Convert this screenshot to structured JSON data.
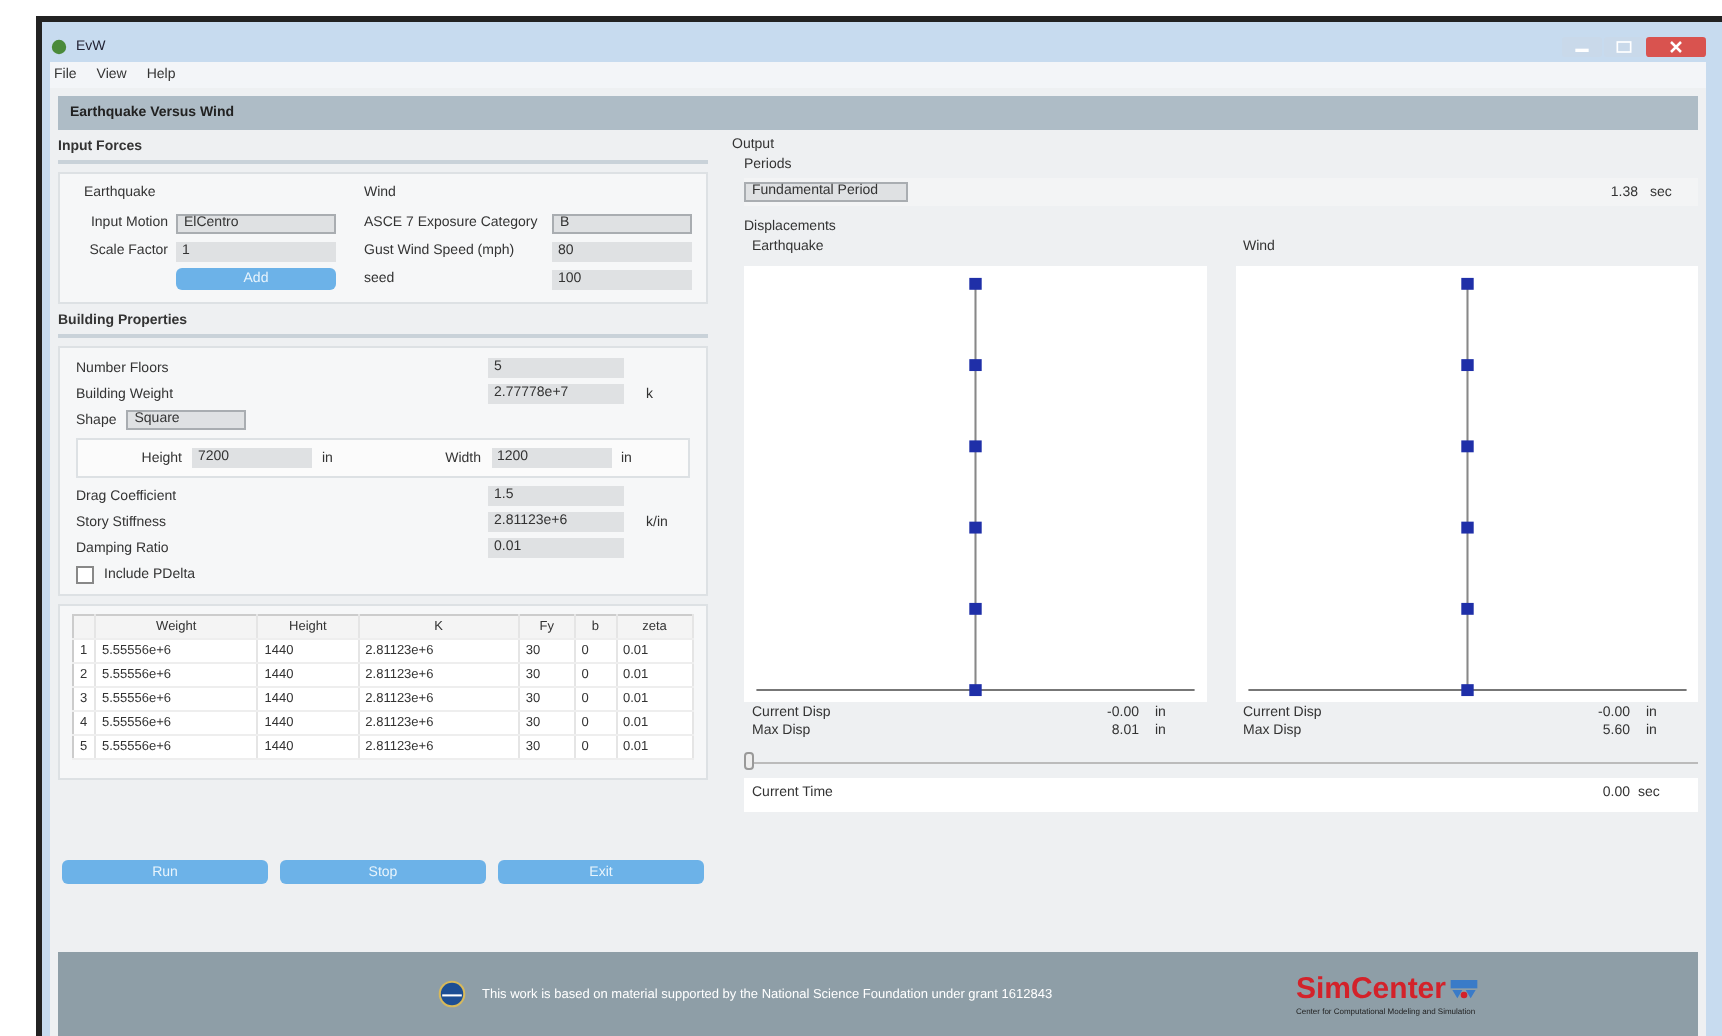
{
  "window": {
    "title": "EvW"
  },
  "menu": [
    "File",
    "View",
    "Help"
  ],
  "header": "Earthquake Versus Wind",
  "input_forces": {
    "title": "Input Forces",
    "earthquake": {
      "title": "Earthquake",
      "fields": [
        {
          "label": "Input Motion",
          "value": "ElCentro",
          "kind": "dropdown"
        },
        {
          "label": "Scale Factor",
          "value": "1",
          "kind": "text"
        }
      ],
      "button": "Add"
    },
    "wind": {
      "title": "Wind",
      "fields": [
        {
          "label": "ASCE 7 Exposure Category",
          "value": "B",
          "kind": "dropdown"
        },
        {
          "label": "Gust Wind Speed (mph)",
          "value": "80",
          "kind": "text"
        },
        {
          "label": "seed",
          "value": "100",
          "kind": "text"
        }
      ]
    }
  },
  "building": {
    "title": "Building Properties",
    "fields": [
      {
        "label": "Number Floors",
        "value": "5"
      },
      {
        "label": "Building Weight",
        "value": "2.77778e+7",
        "unit": "k"
      }
    ],
    "shape": {
      "label": "Shape",
      "value": "Square"
    },
    "dims": [
      {
        "label": "Height",
        "value": "7200",
        "unit": "in"
      },
      {
        "label": "Width",
        "value": "1200",
        "unit": "in"
      }
    ],
    "fields2": [
      {
        "label": "Drag Coefficient",
        "value": "1.5"
      },
      {
        "label": "Story Stiffness",
        "value": "2.81123e+6",
        "unit": "k/in"
      },
      {
        "label": "Damping Ratio",
        "value": "0.01"
      }
    ],
    "pdelta": {
      "label": "Include PDelta",
      "checked": false
    }
  },
  "table": {
    "columns": [
      "Weight",
      "Height",
      "K",
      "Fy",
      "b",
      "zeta"
    ],
    "rows": [
      {
        "index": "1",
        "cells": [
          "5.55556e+6",
          "1440",
          "2.81123e+6",
          "30",
          "0",
          "0.01"
        ]
      },
      {
        "index": "2",
        "cells": [
          "5.55556e+6",
          "1440",
          "2.81123e+6",
          "30",
          "0",
          "0.01"
        ]
      },
      {
        "index": "3",
        "cells": [
          "5.55556e+6",
          "1440",
          "2.81123e+6",
          "30",
          "0",
          "0.01"
        ]
      },
      {
        "index": "4",
        "cells": [
          "5.55556e+6",
          "1440",
          "2.81123e+6",
          "30",
          "0",
          "0.01"
        ]
      },
      {
        "index": "5",
        "cells": [
          "5.55556e+6",
          "1440",
          "2.81123e+6",
          "30",
          "0",
          "0.01"
        ]
      }
    ]
  },
  "buttons": [
    "Run",
    "Stop",
    "Exit"
  ],
  "output": {
    "title": "Output",
    "periods": {
      "title": "Periods",
      "label": "Fundamental Period",
      "value": "1.38",
      "unit": "sec"
    },
    "displacements": {
      "title": "Displacements",
      "plots": [
        {
          "title": "Earthquake",
          "readings": [
            {
              "label": "Current Disp",
              "value": "-0.00",
              "unit": "in"
            },
            {
              "label": "Max Disp",
              "value": "8.01",
              "unit": "in"
            }
          ]
        },
        {
          "title": "Wind",
          "readings": [
            {
              "label": "Current Disp",
              "value": "-0.00",
              "unit": "in"
            },
            {
              "label": "Max Disp",
              "value": "5.60",
              "unit": "in"
            }
          ]
        }
      ]
    },
    "time": {
      "level": 0,
      "label": "Current Time",
      "value": "0.00",
      "unit": "sec"
    }
  },
  "footer": {
    "text": "This work is based on material supported by the National Science Foundation under grant 1612843",
    "logo": "SimCenter",
    "logo_subtitle": "Center for Computational Modeling and Simulation"
  }
}
